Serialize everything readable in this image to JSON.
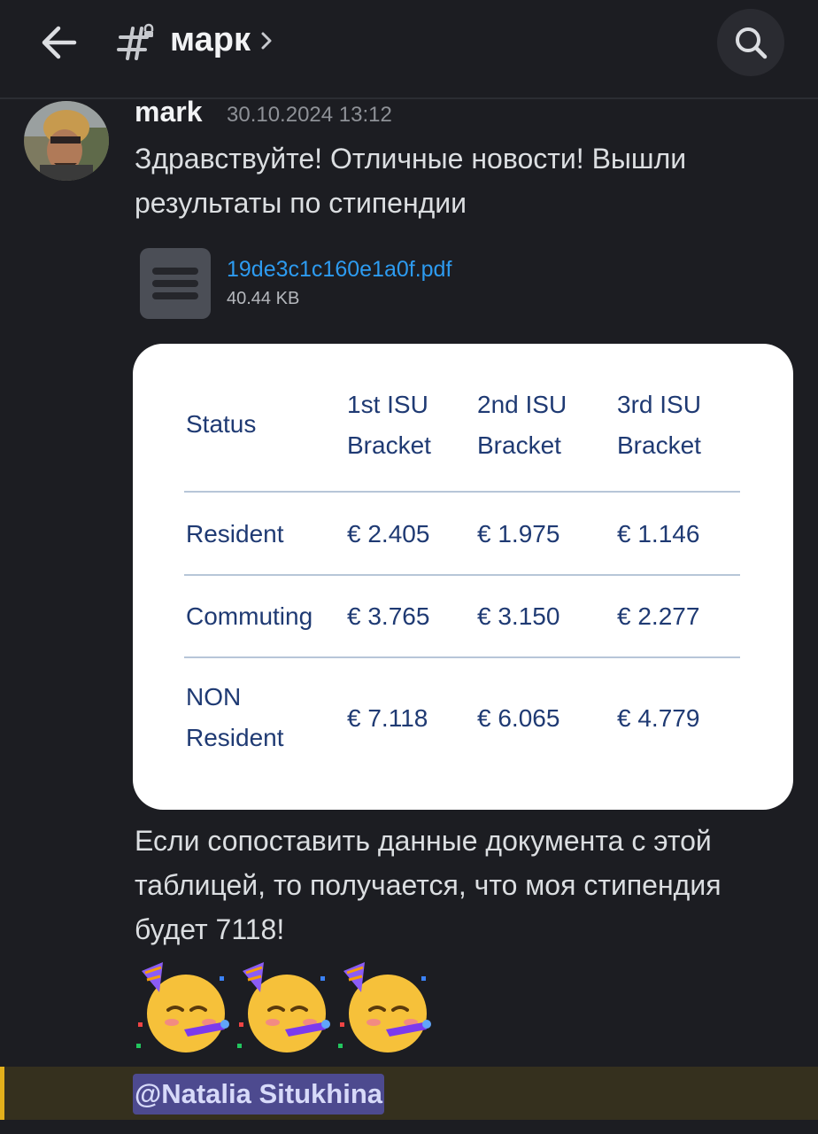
{
  "header": {
    "channel_name": "марк"
  },
  "message": {
    "author": "mark",
    "timestamp": "30.10.2024 13:12",
    "text_1": "Здравствуйте! Отличные новости! Вышли результаты по стипендии",
    "attachment": {
      "file_name": "19de3c1c160e1a0f.pdf",
      "file_size": "40.44 KB"
    },
    "image_table": {
      "headers": [
        "Status",
        "1st ISU\nBracket",
        "2nd ISU\nBracket",
        "3rd ISU\nBracket"
      ],
      "rows": [
        [
          "Resident",
          "€ 2.405",
          "€ 1.975",
          "€ 1.146"
        ],
        [
          "Commuting",
          "€ 3.765",
          "€ 3.150",
          "€ 2.277"
        ],
        [
          "NON\nResident",
          "€ 7.118",
          "€ 6.065",
          "€ 4.779"
        ]
      ]
    },
    "text_2": "Если сопоставить данные документа с этой таблицей, то получается, что моя стипендия будет 7118!",
    "emojis": [
      "partying-face",
      "partying-face",
      "partying-face"
    ],
    "mention": "@Natalia Situkhina"
  },
  "colors": {
    "background": "#1c1d22",
    "link": "#2d9bf0",
    "table_text": "#1f3a73",
    "mention_bg": "#4d4a8f",
    "highlight_accent": "#e3b01b"
  }
}
